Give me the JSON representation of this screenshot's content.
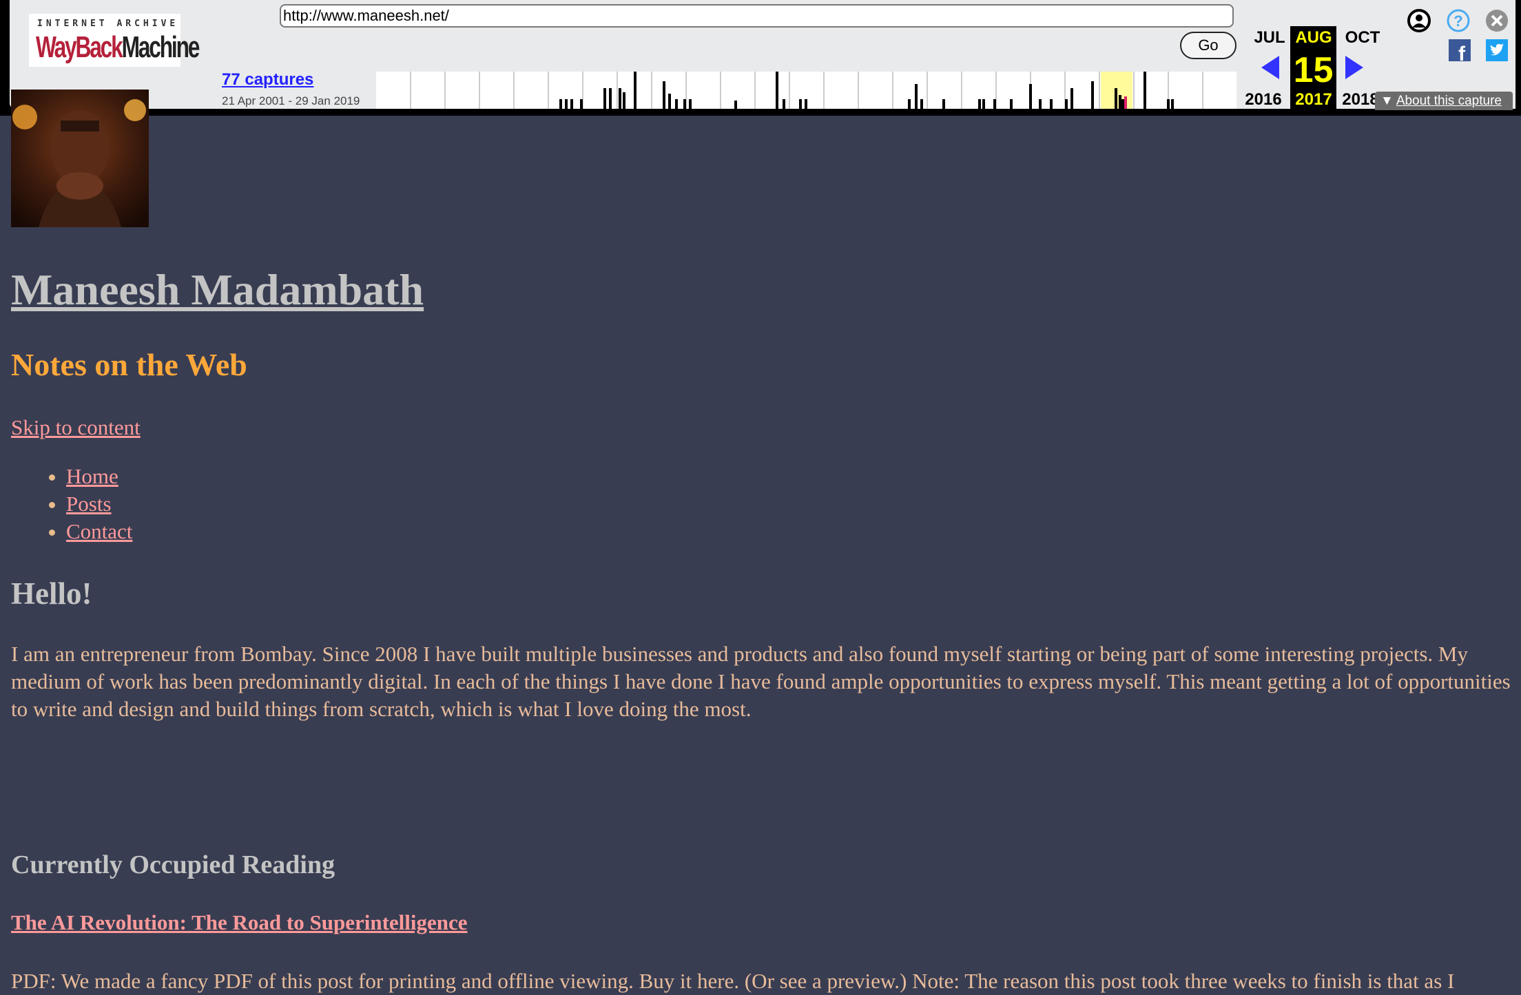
{
  "wayback": {
    "logo_top": "INTERNET ARCHIVE",
    "logo_way": "WayBack",
    "logo_machine": "Machine",
    "url": "http://www.maneesh.net/",
    "go_label": "Go",
    "captures_label": "77 captures",
    "date_range": "21 Apr 2001 - 29 Jan 2019",
    "prev_month": "JUL",
    "cur_month": "AUG",
    "next_month": "OCT",
    "cur_day": "15",
    "prev_year": "2016",
    "cur_year": "2017",
    "next_year": "2018",
    "about_label": "About this capture",
    "colors": {
      "toolbar_bg": "#e9eaec",
      "link": "#2222ff",
      "current": "#ffff00",
      "arrow": "#3333ff",
      "highlight": "#fffa9a",
      "current_capture": "#e0206a"
    }
  },
  "page": {
    "title": "Maneesh Madambath",
    "tagline": "Notes on the Web",
    "skip_link": "Skip to content",
    "nav": [
      {
        "label": "Home"
      },
      {
        "label": "Posts"
      },
      {
        "label": "Contact"
      }
    ],
    "hello_heading": "Hello!",
    "intro": "I am an entrepreneur from Bombay. Since 2008 I have built multiple businesses and products and also found myself starting or being part of some interesting projects. My medium of work has been predominantly digital. In each of the things I have done I have found ample opportunities to express myself. This meant getting a lot of opportunities to write and design and build things from scratch, which is what I love doing the most.",
    "reading_heading": "Currently Occupied Reading",
    "reading_link": "The AI Revolution: The Road to Superintelligence",
    "reading_excerpt": "PDF: We made a fancy PDF of this post for printing and offline viewing. Buy it here. (Or see a preview.) Note: The reason this post took three weeks to finish is that as I",
    "colors": {
      "background": "#393d52",
      "title": "#c4c4c4",
      "tagline": "#ffa83a",
      "link": "#ff9a9a",
      "text": "#e8bc9a"
    }
  }
}
